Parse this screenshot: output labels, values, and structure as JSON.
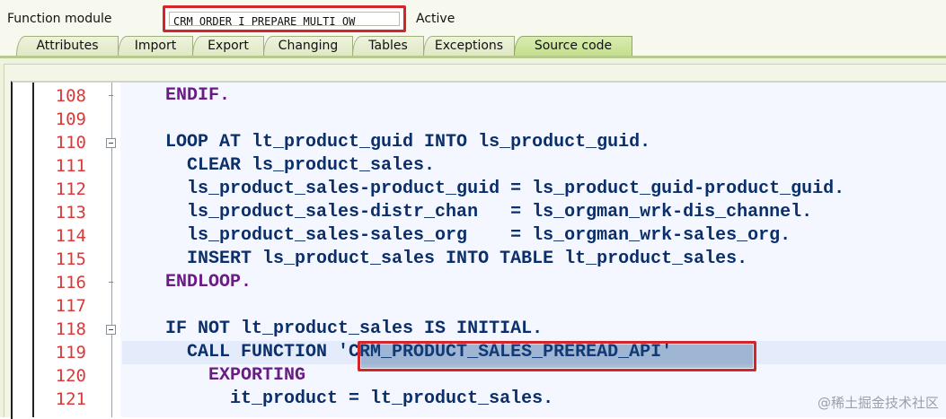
{
  "header": {
    "label": "Function module",
    "name": "CRM_ORDER_I_PREPARE_MULTI_OW",
    "status": "Active"
  },
  "tabs": [
    {
      "label": "Attributes"
    },
    {
      "label": "Import"
    },
    {
      "label": "Export"
    },
    {
      "label": "Changing"
    },
    {
      "label": "Tables"
    },
    {
      "label": "Exceptions"
    },
    {
      "label": "Source code",
      "active": true
    }
  ],
  "editor": {
    "lines": [
      {
        "num": "108",
        "text": "    ENDIF."
      },
      {
        "num": "109",
        "text": ""
      },
      {
        "num": "110",
        "text": "    LOOP AT lt_product_guid INTO ls_product_guid."
      },
      {
        "num": "111",
        "text": "      CLEAR ls_product_sales."
      },
      {
        "num": "112",
        "text": "      ls_product_sales-product_guid = ls_product_guid-product_guid."
      },
      {
        "num": "113",
        "text": "      ls_product_sales-distr_chan   = ls_orgman_wrk-dis_channel."
      },
      {
        "num": "114",
        "text": "      ls_product_sales-sales_org    = ls_orgman_wrk-sales_org."
      },
      {
        "num": "115",
        "text": "      INSERT ls_product_sales INTO TABLE lt_product_sales."
      },
      {
        "num": "116",
        "text": "    ENDLOOP."
      },
      {
        "num": "117",
        "text": ""
      },
      {
        "num": "118",
        "text": "    IF NOT lt_product_sales IS INITIAL."
      },
      {
        "num": "119",
        "text": "      CALL FUNCTION 'CRM_PRODUCT_SALES_PREREAD_API'"
      },
      {
        "num": "120",
        "text": "        EXPORTING"
      },
      {
        "num": "121",
        "text": "          it_product = lt_product_sales."
      }
    ]
  },
  "watermark": "@稀土掘金技术社区"
}
